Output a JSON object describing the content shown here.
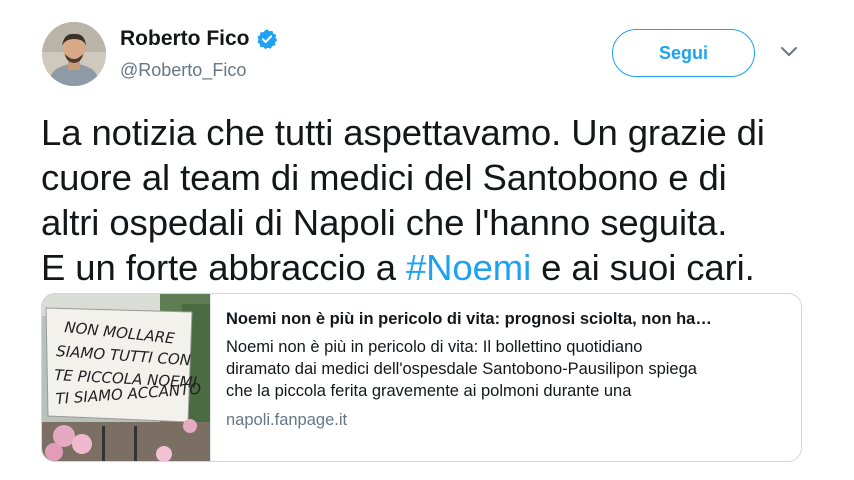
{
  "author": {
    "display_name": "Roberto Fico",
    "handle": "@Roberto_Fico",
    "verified": true,
    "avatar_icon": "user-avatar"
  },
  "actions": {
    "follow_label": "Segui",
    "menu_icon": "chevron-down-icon"
  },
  "tweet": {
    "lines": [
      "La notizia che tutti aspettavamo. Un grazie di",
      "cuore al team di medici del Santobono e di",
      "altri ospedali di Napoli che l'hanno seguita.",
      "E un forte abbraccio a "
    ],
    "hashtag": "#Noemi",
    "after_hashtag": " e ai suoi cari."
  },
  "card": {
    "title": "Noemi non è più in pericolo di vita: prognosi sciolta, non ha…",
    "description_lines": [
      "Noemi non è più in pericolo di vita: Il bollettino quotidiano",
      "diramato dai medici dell'ospesdale Santobono-Pausilipon spiega",
      "che la piccola ferita gravemente ai polmoni durante una"
    ],
    "domain": "napoli.fanpage.it",
    "image_banner_text": [
      "NON MOLLARE",
      "SIAMO TUTTI CON",
      "TE PICCOLA NOEMI",
      "TI SIAMO ACCANTO"
    ]
  },
  "colors": {
    "accent": "#1da1f2",
    "text": "#14171a",
    "secondary_text": "#657786",
    "border": "#cfd9de"
  }
}
